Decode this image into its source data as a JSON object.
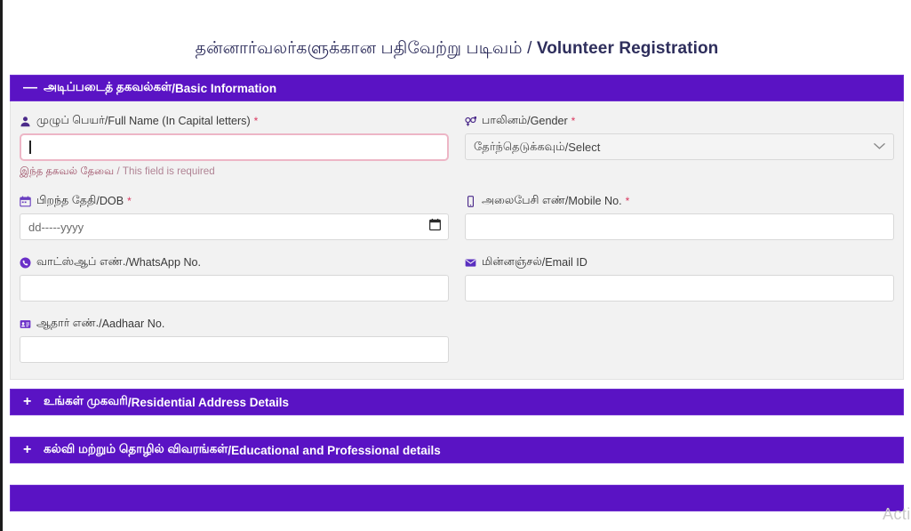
{
  "page": {
    "title_ta": "தன்னார்வலர்களுக்கான பதிவேற்று படிவம்",
    "title_sep": " / ",
    "title_en": "Volunteer Registration"
  },
  "sections": [
    {
      "sign": "—",
      "label_ta": "அடிப்படைத் தகவல்கள்",
      "label_sep": " / ",
      "label_en": "Basic Information",
      "expanded": true
    },
    {
      "sign": "+",
      "label_ta": "உங்கள் முகவரி",
      "label_sep": " / ",
      "label_en": "Residential Address Details",
      "expanded": false
    },
    {
      "sign": "+",
      "label_ta": "கல்வி மற்றும் தொழில் விவரங்கள்",
      "label_sep": " / ",
      "label_en": "Educational and Professional details",
      "expanded": false
    }
  ],
  "fields": {
    "full_name": {
      "icon": "person-icon",
      "label_ta": "முழுப் பெயர்",
      "label_sep": " / ",
      "label_en": "Full Name (In Capital letters)",
      "required_mark": "*",
      "value": "",
      "error_ta": "இந்த தகவல் தேவை",
      "error_sep": " / ",
      "error_en": "This field is required"
    },
    "gender": {
      "icon": "gender-icon",
      "label_ta": "பாலினம்",
      "label_sep": " / ",
      "label_en": "Gender",
      "required_mark": "*",
      "selected_ta": "தேர்ந்தெடுக்கவும்",
      "selected_sep": " / ",
      "selected_en": "Select"
    },
    "dob": {
      "icon": "calendar-icon",
      "label_ta": "பிறந்த தேதி",
      "label_sep": " / ",
      "label_en": "DOB",
      "required_mark": "*",
      "placeholder": "dd-----yyyy",
      "value": ""
    },
    "mobile": {
      "icon": "mobile-phone-icon",
      "label_ta": "அலைபேசி எண்",
      "label_sep": " / ",
      "label_en": "Mobile No.",
      "required_mark": "*",
      "value": ""
    },
    "whatsapp": {
      "icon": "whatsapp-icon",
      "label_ta": "வாட்ஸ்ஆப் எண்.",
      "label_sep": " / ",
      "label_en": "WhatsApp No.",
      "required_mark": "",
      "value": ""
    },
    "email": {
      "icon": "envelope-icon",
      "label_ta": "மின்னஞ்சல்",
      "label_sep": " / ",
      "label_en": "Email ID",
      "required_mark": "",
      "value": ""
    },
    "aadhaar": {
      "icon": "id-card-icon",
      "label_ta": "ஆதார் எண்.",
      "label_sep": " / ",
      "label_en": "Aadhaar No.",
      "required_mark": "",
      "value": ""
    }
  },
  "watermark": {
    "text": "Acti"
  },
  "colors": {
    "accent_purple": "#5a13c4",
    "required_red": "#d9365e",
    "error_text": "#9e5068",
    "error_border": "#edb6c6",
    "panel_bg": "#f2f2f2",
    "title_text": "#2e2e5c"
  }
}
